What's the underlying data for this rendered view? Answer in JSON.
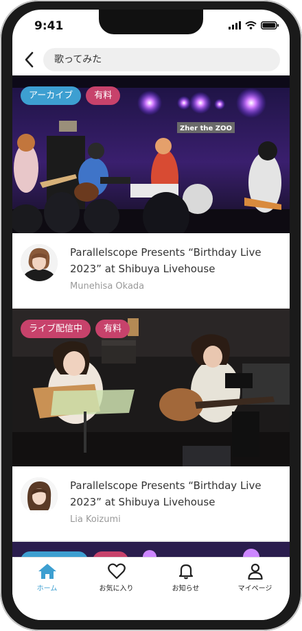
{
  "status_bar": {
    "time": "9:41"
  },
  "search": {
    "query": "歌ってみた"
  },
  "cards": [
    {
      "badges": [
        "アーカイブ",
        "有料"
      ],
      "venue_sign": "Zher the ZOO",
      "title": "Parallelscope Presents “Birthday Live 2023” at Shibuya Livehouse",
      "artist": "Munehisa Okada"
    },
    {
      "badges": [
        "ライブ配信中",
        "有料"
      ],
      "title": "Parallelscope Presents “Birthday Live 2023” at Shibuya Livehouse",
      "artist": "Lia Koizumi"
    }
  ],
  "tabbar": {
    "home": "ホーム",
    "favorites": "お気に入り",
    "notifications": "お知らせ",
    "mypage": "マイページ"
  },
  "colors": {
    "accent": "#3d9fd1",
    "pink": "#c7426b"
  }
}
